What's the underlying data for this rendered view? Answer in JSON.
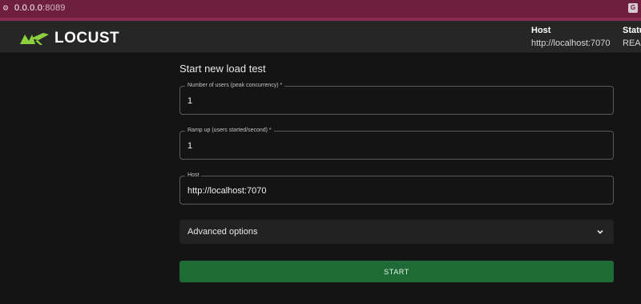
{
  "browser": {
    "site_icon": "⚙",
    "url_host": "0.0.0.0",
    "url_port": ":8089",
    "translate_icon": "G"
  },
  "header": {
    "logo_text": "LOCUST",
    "host_label": "Host",
    "host_value": "http://localhost:7070",
    "status_label": "Statu",
    "status_value": "READ"
  },
  "form": {
    "title": "Start new load test",
    "users_legend": "Number of users (peak concurrency) *",
    "users_value": "1",
    "ramp_legend": "Ramp up (users started/second) *",
    "ramp_value": "1",
    "host_legend": "Host",
    "host_value": "http://localhost:7070",
    "advanced_label": "Advanced options",
    "start_label": "START"
  },
  "colors": {
    "accent": "#1e6b35",
    "logo_green": "#8ccf3f",
    "browser_bar": "#6e1f3e"
  }
}
